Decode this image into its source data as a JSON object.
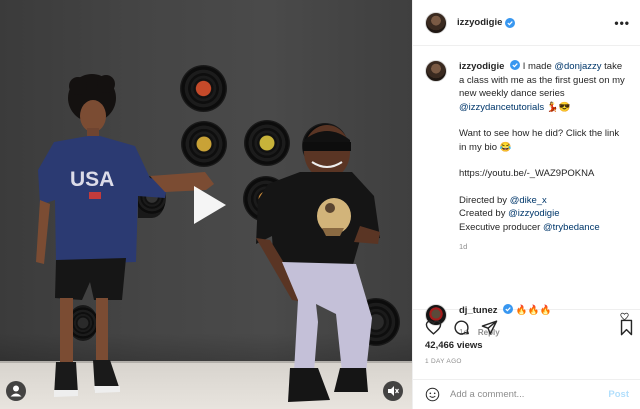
{
  "post": {
    "username": "izzyodigie",
    "verified": true
  },
  "caption": {
    "username": "izzyodigie",
    "line1_a": "I made ",
    "mention_1": "@donjazzy",
    "line1_b": " take a class with me as the first guest on my new weekly dance series ",
    "mention_2": "@izzydancetutorials",
    "line1_emoji": " 💃😎",
    "line2": "Want to see how he did? Click the link in my bio 😂",
    "url": "https://youtu.be/-_WAZ9POKNA",
    "directed_label": "Directed by ",
    "directed_mention": "@dike_x",
    "created_label": "Created by ",
    "created_mention": "@izzyodigie",
    "producer_label": "Executive producer ",
    "producer_mention": "@trybedance",
    "time": "1d"
  },
  "comment": {
    "username": "dj_tunez",
    "verified": true,
    "text": "🔥🔥🔥",
    "time": "1d",
    "reply_label": "Reply"
  },
  "actions": {
    "icons": [
      "heart-icon",
      "comment-icon",
      "share-icon",
      "bookmark-icon"
    ]
  },
  "stats": {
    "views": "42,466 views",
    "posted": "1 DAY AGO"
  },
  "add_comment": {
    "placeholder": "Add a comment...",
    "post_label": "Post"
  },
  "colors": {
    "verified_blue": "#3897f0",
    "link": "#00376b",
    "muted": "#8e8e8e",
    "post_disabled": "#b2dffc"
  },
  "video": {
    "overlay_icons": [
      "play-icon",
      "user-tag-icon",
      "mute-icon"
    ]
  }
}
